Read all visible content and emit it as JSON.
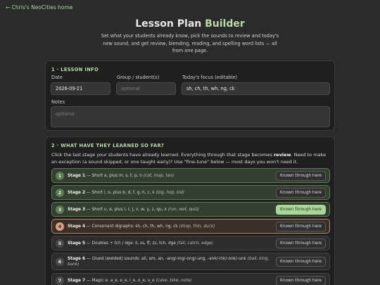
{
  "nav": {
    "back_label": "← Chris's NeoCities home"
  },
  "header": {
    "title_main": "Lesson Plan",
    "title_accent": "Builder",
    "subtitle": "Set what your students already know, pick the sounds to review and today's new sound, and get review, blending, reading, and spelling word lists — all from one page."
  },
  "lesson_info": {
    "heading": "1 · LESSON INFO",
    "date_label": "Date",
    "date_value": "2026-09-21",
    "group_label": "Group / student(s)",
    "group_placeholder": "optional",
    "focus_label": "Today's focus (editable)",
    "focus_value": "sh, ch, th, wh, ng, ck",
    "notes_label": "Notes",
    "notes_placeholder": "optional"
  },
  "stages_section": {
    "heading": "2 · WHAT HAVE THEY LEARNED SO FAR?",
    "intro_pre": "Click the last stage your students have already learned. Everything through that stage becomes ",
    "intro_bold": "review",
    "intro_post": ". Need to make an exception (a sound skipped, or one taught early)? Use \"fine-tune\" below — most days you won't need it.",
    "button_label": "Known through here",
    "stages": [
      {
        "num": "1",
        "name": "Stage 1",
        "desc": "Short a, plus m, s, t, p, n",
        "examples": "(cat, map, tan)",
        "state": "covered"
      },
      {
        "num": "2",
        "name": "Stage 2",
        "desc": "Short i, o, plus b, d, f, g, h, c, k",
        "examples": "(big, hop, kid)",
        "state": "covered"
      },
      {
        "num": "3",
        "name": "Stage 3",
        "desc": "Short u, e, plus l, r, j, v, w, y, z, qu, x",
        "examples": "(run, wet, quiz)",
        "state": "selected"
      },
      {
        "num": "4",
        "name": "Stage 4",
        "desc": "Consonant digraphs: sh, ch, th, wh, ng, ck",
        "examples": "(shop, thin, duck)",
        "state": "current"
      },
      {
        "num": "5",
        "name": "Stage 5",
        "desc": "Doubles + tch / dge: ll, ss, ff, zz, tch, dge",
        "examples": "(fall, catch, edge)",
        "state": "default"
      },
      {
        "num": "6",
        "name": "Stage 6",
        "desc": "Glued (welded) sounds: all, am, an, -ang/-ing/-ong/-ung, -ank/-ink/-onk/-unk",
        "examples": "(ball, king, bank)",
        "state": "default"
      },
      {
        "num": "7",
        "name": "Stage 7",
        "desc": "Magic e: a_e, e_e, i_e, o_e, u_e",
        "examples": "(cake, bike, note)",
        "state": "default"
      }
    ]
  }
}
